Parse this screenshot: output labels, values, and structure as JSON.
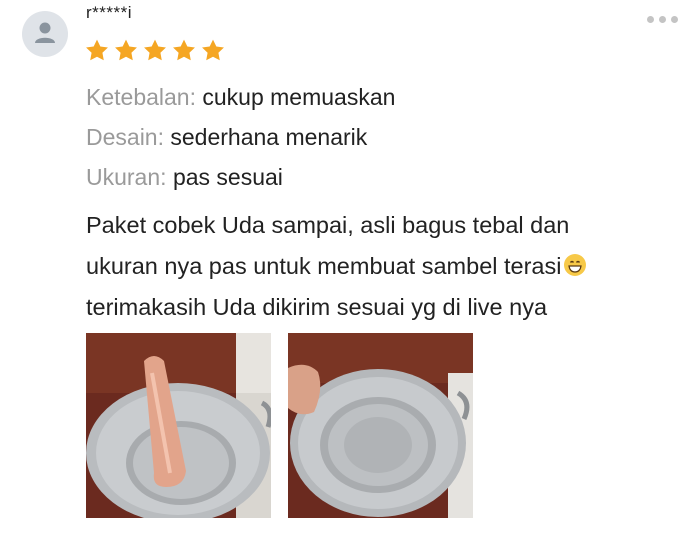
{
  "review": {
    "username": "r*****i",
    "rating": 5,
    "max_rating": 5,
    "star_color": "#f5a623",
    "attributes": [
      {
        "label": "Ketebalan:",
        "value": "cukup memuaskan"
      },
      {
        "label": "Desain:",
        "value": "sederhana menarik"
      },
      {
        "label": "Ukuran:",
        "value": "pas sesuai"
      }
    ],
    "text_lines": [
      "Paket cobek Uda sampai, asli bagus tebal dan",
      "ukuran nya pas untuk membuat sambel terasi",
      "terimakasih Uda dikirim sesuai yg di live nya"
    ],
    "emoji": "grinning-face",
    "photos": [
      "photo-cobek-with-pestle",
      "photo-cobek-empty"
    ]
  },
  "icons": {
    "avatar": "user-icon",
    "menu": "more-horizontal-icon"
  }
}
